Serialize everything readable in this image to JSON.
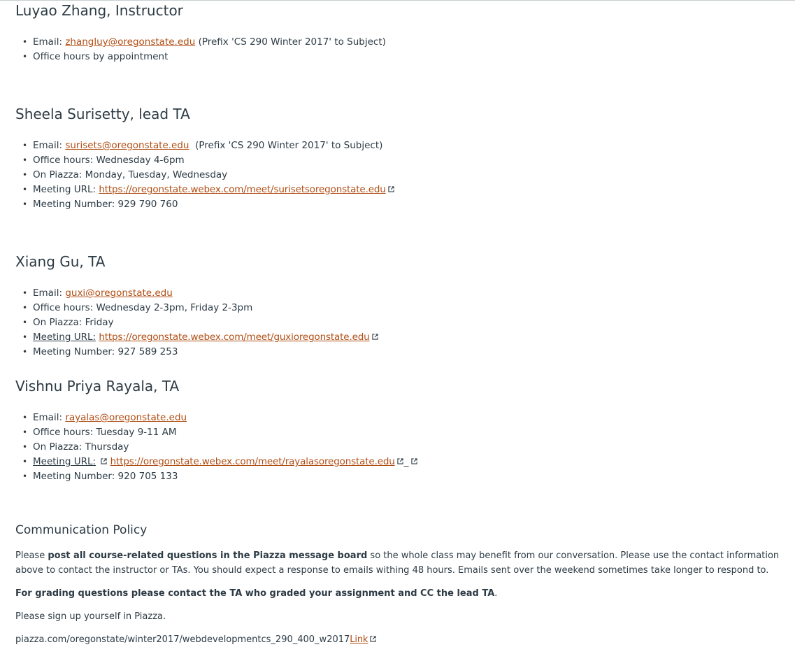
{
  "instructor": {
    "heading": "Luyao Zhang, Instructor",
    "email_label": "Email:",
    "email": "zhangluy@oregonstate.edu",
    "email_note": "(Prefix 'CS 290 Winter 2017' to Subject)",
    "office_hours": "Office hours by appointment"
  },
  "lead_ta": {
    "heading": "Sheela Surisetty, lead TA",
    "email_label": "Email:",
    "email": "surisets@oregonstate.edu",
    "email_note": "(Prefix 'CS 290 Winter 2017' to Subject)",
    "office_hours": "Office hours: Wednesday 4-6pm",
    "piazza": "On Piazza: Monday, Tuesday, Wednesday",
    "meeting_url_label": "Meeting URL:",
    "meeting_url": "https://oregonstate.webex.com/meet/surisetsoregonstate.edu",
    "meeting_number": "Meeting Number: 929 790 760"
  },
  "ta_xiang": {
    "heading": "Xiang Gu, TA",
    "email_label": "Email:",
    "email": "guxi@oregonstate.edu",
    "office_hours": "Office hours: Wednesday 2-3pm, Friday 2-3pm",
    "piazza": "On Piazza: Friday",
    "meeting_url_label": "Meeting URL:",
    "meeting_url": "https://oregonstate.webex.com/meet/guxioregonstate.edu",
    "meeting_number": "Meeting Number: 927 589 253"
  },
  "ta_vishnu": {
    "heading": "Vishnu Priya Rayala, TA",
    "email_label": "Email:",
    "email": "rayalas@oregonstate.edu",
    "office_hours": "Office hours: Tuesday 9-11 AM",
    "piazza": "On Piazza: Thursday",
    "meeting_url_label": "Meeting URL:",
    "meeting_url": "https://oregonstate.webex.com/meet/rayalasoregonstate.edu",
    "meeting_url_sep": "_",
    "meeting_number": "Meeting Number: 920 705 133"
  },
  "policy": {
    "heading": "Communication Policy",
    "p1_pre": "Please ",
    "p1_bold": "post all course-related questions in the Piazza message board",
    "p1_post": " so the whole class may benefit from our conversation. Please use the contact information above to contact the instructor or TAs. You should expect a response to emails withing 48 hours. Emails sent over the weekend sometimes take longer to respond to.",
    "p2_bold": "For grading questions please contact the TA who graded your assignment and CC the lead TA",
    "p2_end": ".",
    "p3": "Please sign up yourself in Piazza.",
    "piazza_url_text": "piazza.com/oregonstate/winter2017/webdevelopmentcs_290_400_w2017",
    "piazza_link_label": "Link"
  },
  "colors": {
    "link": "#b14e14",
    "text": "#2d3b45"
  },
  "icons": {
    "external_link": "external-link-icon"
  }
}
